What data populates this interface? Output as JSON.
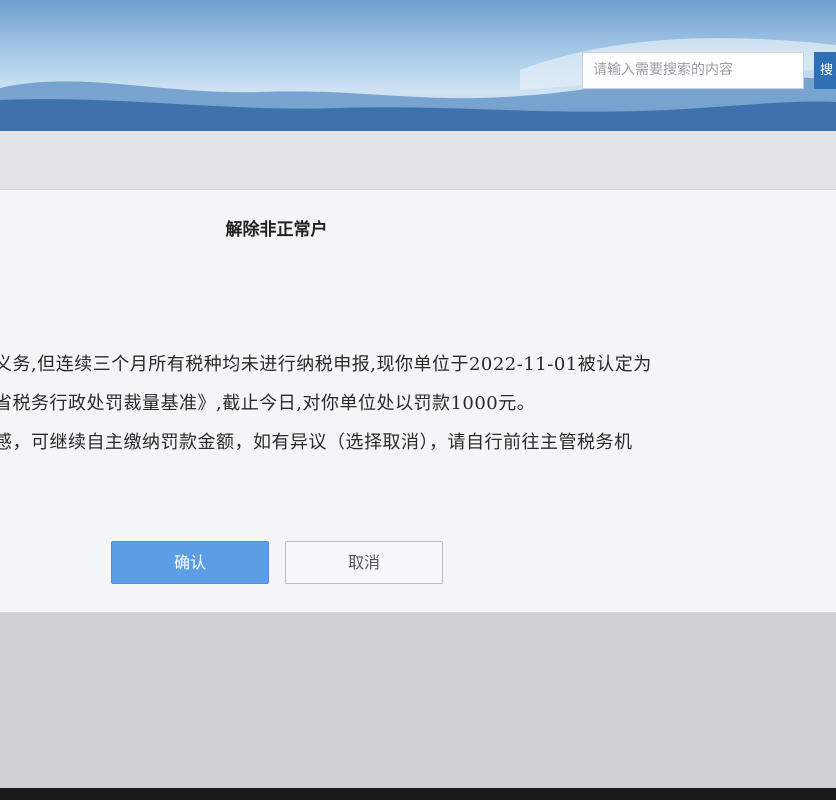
{
  "header": {
    "search_placeholder": "请输入需要搜索的内容",
    "search_button_label": "搜"
  },
  "dialog": {
    "title": "解除非正常户",
    "lines": [
      "义务,但连续三个月所有税种均未进行纳税申报,现你单位于2022-11-01被认定为",
      "省税务行政处罚裁量基准》,截止今日,对你单位处以罚款1000元。",
      "感，可继续自主缴纳罚款金额，如有异议（选择取消），请自行前往主管税务机"
    ],
    "confirm_label": "确认",
    "cancel_label": "取消"
  },
  "colors": {
    "confirm_bg": "#5b9ee6",
    "header_sky": "#a6c9e6"
  }
}
